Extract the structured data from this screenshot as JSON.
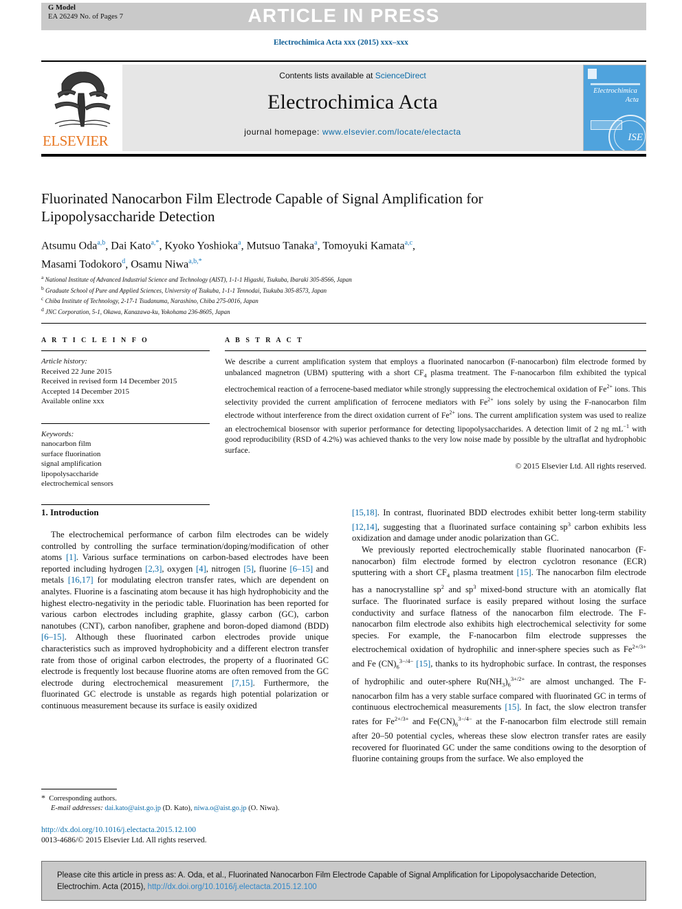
{
  "header": {
    "g_model": "G Model",
    "article_id": "EA 26249 No. of Pages 7",
    "article_in_press": "ARTICLE IN PRESS",
    "journal_ref": "Electrochimica Acta xxx (2015) xxx–xxx"
  },
  "masthead": {
    "contents_prefix": "Contents lists available at ",
    "sciencedirect": "ScienceDirect",
    "journal_title": "Electrochimica Acta",
    "homepage_label": "journal homepage:",
    "homepage_url": "www.elsevier.com/locate/electacta",
    "publisher": "ELSEVIER",
    "cover_title_line1": "Electrochimica",
    "cover_title_line2": "Acta",
    "cover_seal_text": "ISE"
  },
  "article": {
    "title": "Fluorinated Nanocarbon Film Electrode Capable of Signal Amplification for Lipopolysaccharide Detection",
    "authors_line1_parts": [
      {
        "name": "Atsumu Oda",
        "sup": "a,b",
        "sep": ", "
      },
      {
        "name": "Dai Kato",
        "sup": "a,*",
        "sep": ", "
      },
      {
        "name": "Kyoko Yoshioka",
        "sup": "a",
        "sep": ", "
      },
      {
        "name": "Mutsuo Tanaka",
        "sup": "a",
        "sep": ", "
      },
      {
        "name": "Tomoyuki Kamata",
        "sup": "a,c",
        "sep": ","
      }
    ],
    "authors_line2_parts": [
      {
        "name": "Masami Todokoro",
        "sup": "d",
        "sep": ", "
      },
      {
        "name": "Osamu Niwa",
        "sup": "a,b,*",
        "sep": ""
      }
    ],
    "affiliations": [
      {
        "marker": "a",
        "text": "National Institute of Advanced Industrial Science and Technology (AIST), 1-1-1 Higashi, Tsukuba, Ibaraki 305-8566, Japan"
      },
      {
        "marker": "b",
        "text": "Graduate School of Pure and Applied Sciences, University of Tsukuba, 1-1-1 Tennodai, Tsukuba 305-8573, Japan"
      },
      {
        "marker": "c",
        "text": "Chiba Institute of Technology, 2-17-1 Tsudanuma, Narashino, Chiba 275-0016, Japan"
      },
      {
        "marker": "d",
        "text": "JNC Corporation, 5-1, Okawa, Kanazawa-ku, Yokohama 236-8605, Japan"
      }
    ]
  },
  "article_info": {
    "heading": "A R T I C L E   I N F O",
    "history_label": "Article history:",
    "history": [
      "Received 22 June 2015",
      "Received in revised form 14 December 2015",
      "Accepted 14 December 2015",
      "Available online xxx"
    ],
    "keywords_label": "Keywords:",
    "keywords": [
      "nanocarbon film",
      "surface fluorination",
      "signal amplification",
      "lipopolysaccharide",
      "electrochemical sensors"
    ]
  },
  "abstract": {
    "heading": "A B S T R A C T",
    "copyright": "© 2015 Elsevier Ltd. All rights reserved."
  },
  "body": {
    "intro_heading": "1. Introduction",
    "footnote_corresponding": "Corresponding authors.",
    "footnote_email_label": "E-mail addresses:",
    "footnote_email_1": "dai.kato@aist.go.jp",
    "footnote_email_1_who": "(D. Kato),",
    "footnote_email_2": "niwa.o@aist.go.jp",
    "footnote_email_2_who": "(O. Niwa).",
    "doi_url": "http://dx.doi.org/10.1016/j.electacta.2015.12.100",
    "issn_line": "0013-4686/© 2015 Elsevier Ltd. All rights reserved."
  },
  "cite_box": {
    "text_before": "Please cite this article in press as: A. Oda, et al., Fluorinated Nanocarbon Film Electrode Capable of Signal Amplification for Lipopolysaccharide Detection, Electrochim. Acta (2015), ",
    "link": "http://dx.doi.org/10.1016/j.electacta.2015.12.100"
  },
  "colors": {
    "link_blue": "#1f7ec0",
    "ref_blue": "#0b6ba8",
    "elsevier_orange": "#e87722",
    "cover_blue": "#4fa3dd",
    "grey_bar": "#c9c9c9"
  }
}
